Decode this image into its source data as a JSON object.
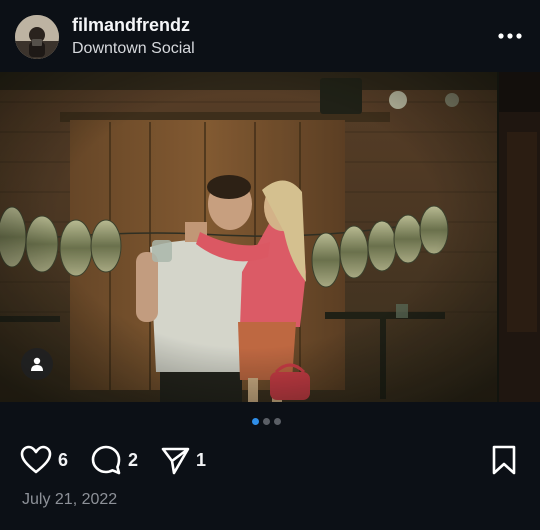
{
  "post": {
    "username": "filmandfrendz",
    "location": "Downtown Social",
    "date": "July 21, 2022",
    "likes": "6",
    "comments": "2",
    "shares": "1"
  },
  "carousel": {
    "total_images": 3,
    "active_index": 0
  },
  "icons": {
    "more": "more-horizontal-icon",
    "user_tag": "user-icon",
    "like": "heart-icon",
    "comment": "comment-icon",
    "share": "send-icon",
    "save": "bookmark-icon"
  },
  "colors": {
    "background": "#0c1016",
    "active_dot": "#2f8ee8",
    "inactive_dot": "#5b5f66",
    "secondary_text": "#8d9198"
  }
}
